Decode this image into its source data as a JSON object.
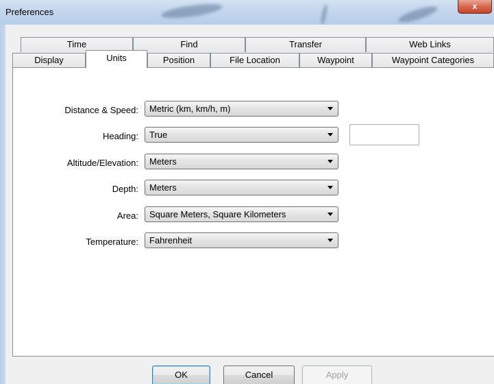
{
  "window": {
    "title": "Preferences",
    "close_glyph": "x"
  },
  "tabs": {
    "row_back": [
      "Time",
      "Find",
      "Transfer",
      "Web Links"
    ],
    "row_front": [
      "Display",
      "Units",
      "Position",
      "File Location",
      "Waypoint",
      "Waypoint Categories"
    ],
    "active": "Units"
  },
  "fields": {
    "distance_speed": {
      "label": "Distance & Speed:",
      "value": "Metric (km, km/h, m)"
    },
    "heading": {
      "label": "Heading:",
      "value": "True",
      "extra_value": ""
    },
    "altitude": {
      "label": "Altitude/Elevation:",
      "value": "Meters"
    },
    "depth": {
      "label": "Depth:",
      "value": "Meters"
    },
    "area": {
      "label": "Area:",
      "value": "Square Meters, Square Kilometers"
    },
    "temperature": {
      "label": "Temperature:",
      "value": "Fahrenheit"
    }
  },
  "buttons": {
    "ok": "OK",
    "cancel": "Cancel",
    "apply": "Apply"
  },
  "icons": {
    "dropdown": "chevron-down-icon",
    "close": "close-icon"
  }
}
